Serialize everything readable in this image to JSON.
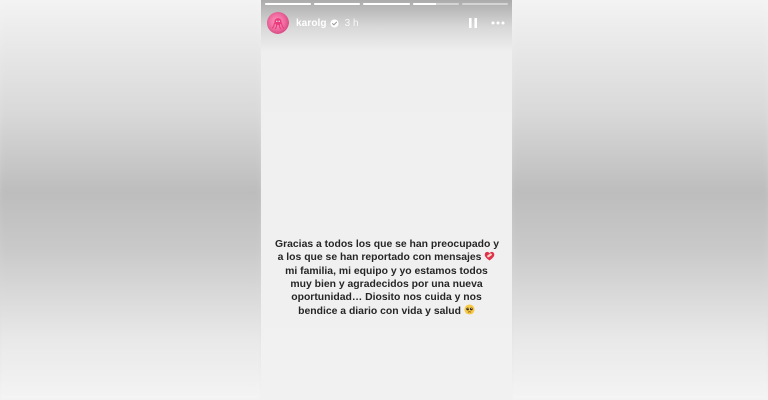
{
  "story": {
    "progress": [
      1,
      1,
      1,
      0.5,
      0
    ],
    "user": {
      "username": "karolg",
      "verified": true,
      "time_ago": "3 h"
    },
    "controls": {
      "pause_icon": "pause-icon",
      "more_icon": "more-options-icon"
    },
    "caption_lines": [
      "Gracias a todos los que se han preocupado y",
      "a los que se han reportado con mensajes",
      "mi familia, mi equipo y yo estamos todos",
      "muy bien y agradecidos por una nueva",
      "oportunidad… Diosito nos cuida y nos",
      "bendice a diario con vida y salud"
    ],
    "emojis": [
      "heart-with-bandage-emoji",
      "pleading-face-emoji"
    ],
    "colors": {
      "caption_text": "#262626",
      "avatar_pink": "#f06a9f"
    }
  }
}
